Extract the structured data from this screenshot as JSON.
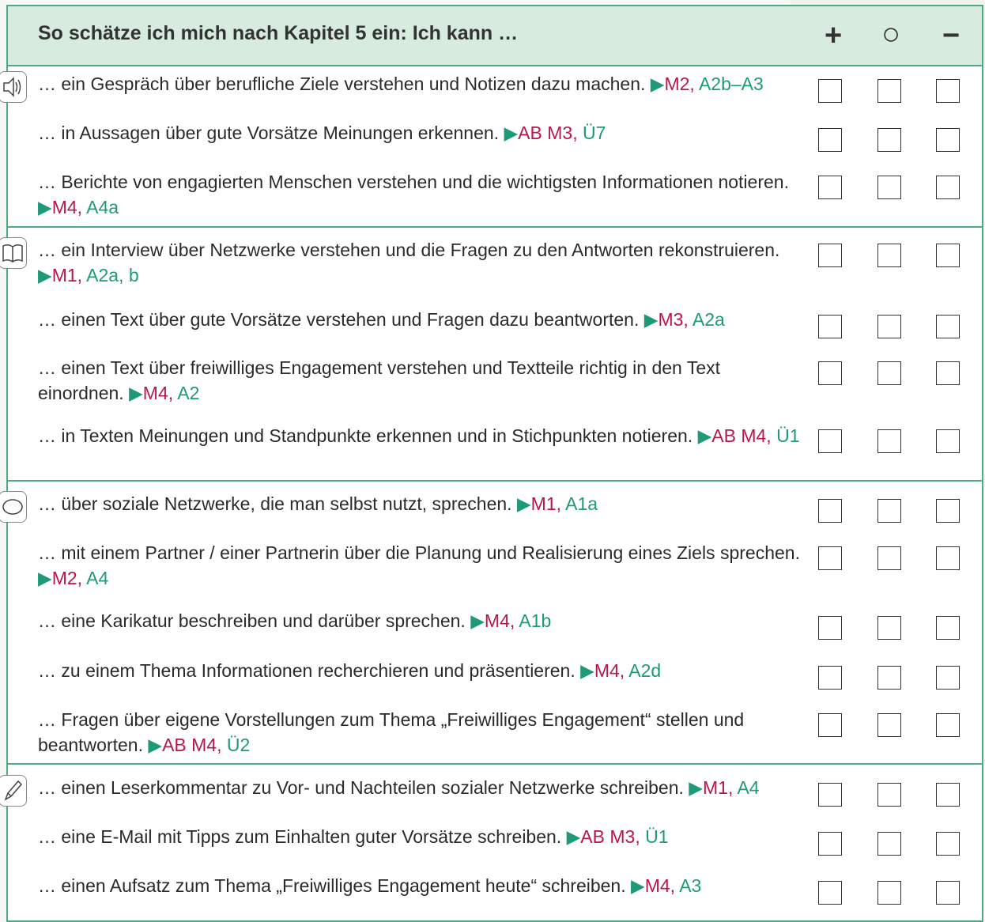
{
  "header": {
    "title": "So schätze ich mich nach Kapitel 5 ein: Ich kann …",
    "plus": "+",
    "circle": "○",
    "minus": "−"
  },
  "sections": [
    {
      "icon": "speaker-icon",
      "rows": [
        {
          "text": "… ein Gespräch über berufliche Ziele verstehen und Notizen dazu machen.",
          "ref_red": "M2,",
          "ref_green": "A2b–A3"
        },
        {
          "text": "… in Aussagen über gute Vorsätze Meinungen erkennen.",
          "ref_red": "AB M3,",
          "ref_green": "Ü7"
        },
        {
          "text": "… Berichte von engagierten Menschen verstehen und die wichtigsten Informationen notieren.",
          "ref_red": "M4,",
          "ref_green": "A4a"
        }
      ]
    },
    {
      "icon": "book-icon",
      "rows": [
        {
          "text": "… ein Interview über Netzwerke verstehen und die Fragen zu den Antworten rekonstruieren.",
          "ref_red": "M1,",
          "ref_green": "A2a, b"
        },
        {
          "text": "… einen Text über gute Vorsätze verstehen und Fragen dazu beantworten.",
          "ref_red": "M3,",
          "ref_green": "A2a"
        },
        {
          "text": "… einen Text über freiwilliges Engagement verstehen und Textteile richtig in den Text einordnen.",
          "ref_red": "M4,",
          "ref_green": "A2"
        },
        {
          "text": "… in Texten Meinungen und Standpunkte erkennen und in Stichpunkten notieren.",
          "ref_red": "AB M4,",
          "ref_green": "Ü1"
        }
      ]
    },
    {
      "icon": "speech-bubble-icon",
      "rows": [
        {
          "text": "… über soziale Netzwerke, die man selbst nutzt, sprechen.",
          "ref_red": "M1,",
          "ref_green": "A1a"
        },
        {
          "text": "… mit einem Partner / einer Partnerin über die Planung und Realisierung eines Ziels sprechen.",
          "ref_red": "M2,",
          "ref_green": "A4"
        },
        {
          "text": "… eine Karikatur beschreiben und darüber sprechen.",
          "ref_red": "M4,",
          "ref_green": "A1b"
        },
        {
          "text": "… zu einem Thema Informationen recherchieren und präsentieren.",
          "ref_red": "M4,",
          "ref_green": "A2d"
        },
        {
          "text": "… Fragen über eigene Vorstellungen zum Thema „Freiwilliges Engagement“ stellen und beantworten.",
          "ref_red": "AB M4,",
          "ref_green": "Ü2"
        }
      ]
    },
    {
      "icon": "pencil-icon",
      "rows": [
        {
          "text": "… einen Leserkommentar zu Vor- und Nachteilen sozialer Netzwerke schreiben.",
          "ref_red": "M1,",
          "ref_green": "A4"
        },
        {
          "text": "… eine E-Mail mit Tipps zum Einhalten guter Vorsätze schreiben.",
          "ref_red": "AB M3,",
          "ref_green": "Ü1"
        },
        {
          "text": "… einen Aufsatz zum Thema „Freiwilliges Engagement heute“ schreiben.",
          "ref_red": "M4,",
          "ref_green": "A3"
        }
      ]
    }
  ],
  "arrow_glyph": "▶"
}
